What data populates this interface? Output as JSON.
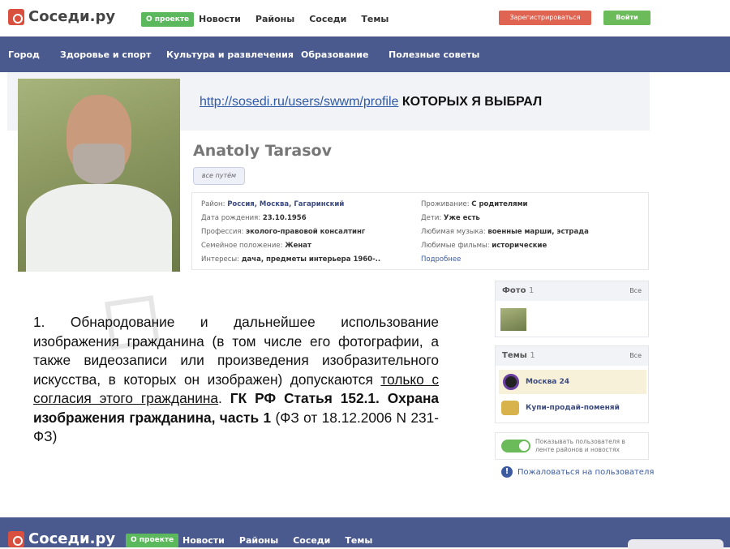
{
  "header": {
    "logo": "Cоседи.ру",
    "about_label": "О проекте",
    "nav": [
      "Новости",
      "Районы",
      "Соседи",
      "Темы"
    ],
    "register_label": "Зарегистрироваться",
    "login_label": "Войти"
  },
  "categories": [
    "Город",
    "Здоровье и спорт",
    "Культура и развлечения",
    "Образование",
    "Полезные советы"
  ],
  "banner": {
    "link": "http://sosedi.ru/users/swwm/profile",
    "text": "КОТОРЫХ Я ВЫБРАЛ"
  },
  "profile": {
    "name": "Anatoly Tarasov",
    "status": "все путём",
    "left": [
      {
        "label": "Район:",
        "value": "Россия, Москва, Гагаринский"
      },
      {
        "label": "Дата рождения:",
        "value": "23.10.1956"
      },
      {
        "label": "Профессия:",
        "value": "эколого-правовой консалтинг"
      },
      {
        "label": "Семейное положение:",
        "value": "Женат"
      },
      {
        "label": "Интересы:",
        "value": "дача, предметы интерьера 1960-.."
      }
    ],
    "right": [
      {
        "label": "Проживание:",
        "value": "С родителями"
      },
      {
        "label": "Дети:",
        "value": "Уже есть"
      },
      {
        "label": "Любимая музыка:",
        "value": "военные марши, эстрада"
      },
      {
        "label": "Любимые фильмы:",
        "value": "исторические"
      }
    ],
    "more_label": "Подробнее"
  },
  "sidebar": {
    "photos": {
      "title": "Фото",
      "count": "1",
      "all": "Все"
    },
    "themes": {
      "title": "Темы",
      "count": "1",
      "all": "Все",
      "items": [
        "Москва 24",
        "Купи-продай-поменяй"
      ]
    },
    "toggle_text": "Показывать пользователя в ленте районов и новостях",
    "report_label": "Пожаловаться на пользователя"
  },
  "law": {
    "p1": "1. Обнародование и дальнейшее использование изображения гражданина (в том числе его фотографии, а также видеозаписи или произведения изобразительного искусства, в которых он изображен) допускаются ",
    "underlined": "только с согласия этого гражданина",
    "p2": ". ",
    "bold": "ГК РФ Статья 152.1. Охрана изображения гражданина, часть 1",
    "p3": " (ФЗ от 18.12.2006 N 231-ФЗ)"
  },
  "footer": {
    "logo": "Cоседи.ру",
    "about_label": "О проекте",
    "nav": [
      "Новости",
      "Районы",
      "Соседи",
      "Темы"
    ]
  },
  "colors": {
    "nav_bg": "#4b5a8e",
    "green": "#5cb85c",
    "red": "#e06452",
    "link": "#3b4a80"
  }
}
